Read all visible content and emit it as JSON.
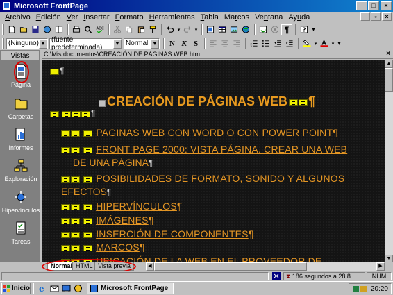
{
  "window": {
    "title": "Microsoft FrontPage"
  },
  "menu": [
    {
      "pre": "",
      "key": "A",
      "post": "rchivo"
    },
    {
      "pre": "",
      "key": "E",
      "post": "dición"
    },
    {
      "pre": "",
      "key": "V",
      "post": "er"
    },
    {
      "pre": "",
      "key": "I",
      "post": "nsertar"
    },
    {
      "pre": "",
      "key": "F",
      "post": "ormato"
    },
    {
      "pre": "",
      "key": "H",
      "post": "erramientas"
    },
    {
      "pre": "",
      "key": "T",
      "post": "abla"
    },
    {
      "pre": "Ma",
      "key": "r",
      "post": "cos"
    },
    {
      "pre": "Ve",
      "key": "n",
      "post": "tana"
    },
    {
      "pre": "Ay",
      "key": "u",
      "post": "da"
    }
  ],
  "format_toolbar": {
    "style_value": "(Ninguno)",
    "font_value": "(fuente predeterminada)",
    "size_value": "Normal",
    "bold": "N",
    "italic": "K",
    "underline": "S"
  },
  "views": {
    "header": "Vistas",
    "items": [
      {
        "label": "Página"
      },
      {
        "label": "Carpetas"
      },
      {
        "label": "Informes"
      },
      {
        "label": "Exploración"
      },
      {
        "label": "Hipervínculos"
      },
      {
        "label": "Tareas"
      }
    ]
  },
  "editor": {
    "path": "C:\\Mis documentos\\CREACIÓN DE PÁGINAS WEB.htm",
    "pilcrow": "¶",
    "heading": "CREACIÓN DE PÁGINAS WEB",
    "links": [
      {
        "text": "PAGINAS WEB CON WORD O CON POWER POINT"
      },
      {
        "text": "FRONT PAGE 2000: VISTA PÁGINA. CREAR UNA WEB",
        "cont": "DE UNA PÁGINA"
      },
      {
        "text": "POSIBILIDADES DE FORMATO, SONIDO Y ALGUNOS",
        "cont": "EFECTOS"
      },
      {
        "text": "HIPERVÍNCULOS"
      },
      {
        "text": "IMÁGENES"
      },
      {
        "text": "INSERCIÓN DE COMPONENTES"
      },
      {
        "text": "MARCOS"
      },
      {
        "text": "UBICACIÓN DE LA WEB EN EL PROVEEDOR DE"
      }
    ]
  },
  "view_tabs": [
    "Normal",
    "HTML",
    "Vista previa"
  ],
  "status": {
    "download_time": "186 segundos a 28.8",
    "num": "NUM"
  },
  "taskbar": {
    "start": "Inicio",
    "task": "Microsoft FrontPage",
    "clock": "20:20"
  },
  "colors": {
    "heading": "#e89a1f",
    "link": "#e39524",
    "title_bar": "#000080",
    "annotation_ring": "#e00000"
  }
}
